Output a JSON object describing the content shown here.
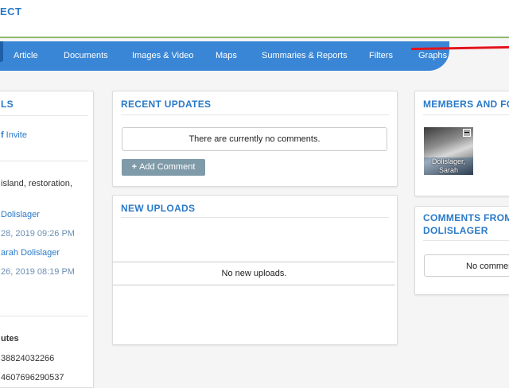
{
  "project_title": "ECT",
  "nav": {
    "items": [
      "Article",
      "Documents",
      "Images & Video",
      "Maps",
      "Summaries & Reports",
      "Filters",
      "Graphs"
    ]
  },
  "left_panel": {
    "title_fragment": "LS",
    "invite_icon": "facebook-icon",
    "invite_label": "Invite",
    "tags": "island, restoration,",
    "creator_name": "Dolislager",
    "created_date": "28, 2019 09:26 PM",
    "modifier_name": "arah Dolislager",
    "modified_date": "26, 2019 08:19 PM",
    "attributes_title": "utes",
    "attr_value_1": "38824032266",
    "attr_value_2": "4607696290537"
  },
  "recent_updates": {
    "title": "RECENT UPDATES",
    "no_comments": "There are currently no comments.",
    "add_comment_label": "Add Comment",
    "add_icon": "plus-icon"
  },
  "new_uploads": {
    "title": "NEW UPLOADS",
    "no_uploads": "No new uploads."
  },
  "members": {
    "title": "MEMBERS AND FOL",
    "member_name": "Dolislager, Sarah"
  },
  "comments_from": {
    "title_line1": "COMMENTS FROM S",
    "title_line2": "DOLISLAGER",
    "no_comments_fragment": "No commer"
  },
  "colors": {
    "accent": "#2a7ac9",
    "nav_bg": "#3a86d6",
    "green_rule": "#8dbb6a",
    "red_mark": "#e4141b",
    "button_gray": "#7f9aa8"
  }
}
